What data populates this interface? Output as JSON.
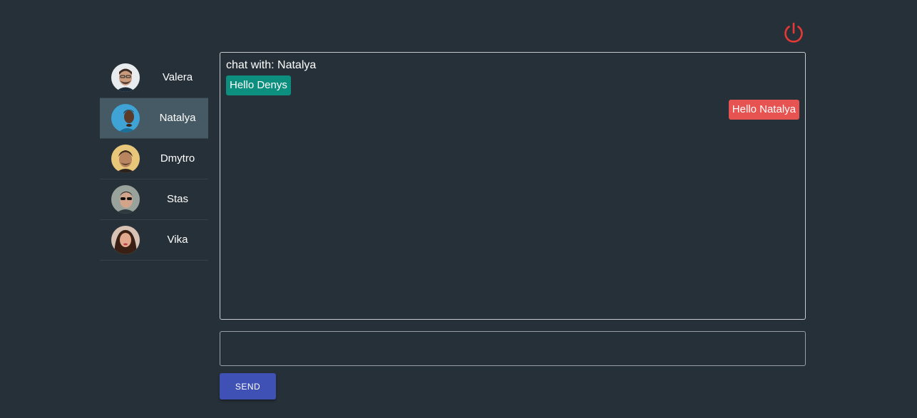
{
  "header": {
    "power_icon": "power-icon",
    "power_color": "#e53935"
  },
  "contacts": [
    {
      "name": "Valera",
      "active": false
    },
    {
      "name": "Natalya",
      "active": true
    },
    {
      "name": "Dmytro",
      "active": false
    },
    {
      "name": "Stas",
      "active": false
    },
    {
      "name": "Vika",
      "active": false
    }
  ],
  "chat": {
    "title": "chat with: Natalya",
    "messages": [
      {
        "text": "Hello Denys",
        "direction": "incoming",
        "color": "#0d8f80"
      },
      {
        "text": "Hello Natalya",
        "direction": "outgoing",
        "color": "#e75350"
      }
    ]
  },
  "composer": {
    "value": "",
    "send_label": "SEND",
    "send_color": "#3f51b5"
  }
}
